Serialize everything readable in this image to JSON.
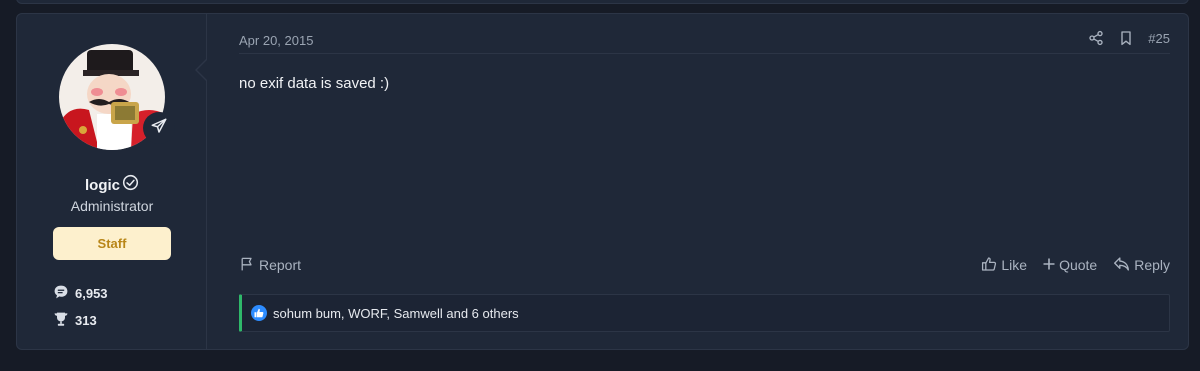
{
  "post": {
    "date": "Apr 20, 2015",
    "number": "#25",
    "body": "no exif data is saved :)"
  },
  "user": {
    "name": "logic",
    "title": "Administrator",
    "badge": "Staff",
    "messages": "6,953",
    "trophies": "313"
  },
  "actions": {
    "report": "Report",
    "like": "Like",
    "quote": "Quote",
    "reply": "Reply"
  },
  "reactions": {
    "text": "sohum bum, WORF, Samwell and 6 others"
  },
  "icons": {
    "share": "share-icon",
    "bookmark": "bookmark-icon",
    "verified": "check-circle-icon",
    "telegram": "paper-plane-icon",
    "messages": "chat-bubble-icon",
    "trophy": "trophy-icon",
    "report": "flag-icon",
    "like": "thumbs-up-icon",
    "quote": "plus-icon",
    "reply": "reply-icon"
  },
  "colors": {
    "accent_green": "#2fb86a",
    "like_blue": "#2d8cff",
    "staff_bg": "#fdf0cd",
    "staff_text": "#b88618"
  }
}
